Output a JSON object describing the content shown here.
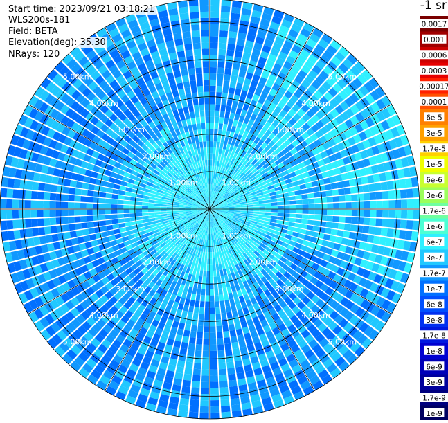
{
  "header": {
    "start_time": "Start time: 2023/09/21 03:18:21",
    "instrument": "WLS200s-181",
    "field": "Field: BETA",
    "elevation": "Elevation(deg): 35.30",
    "nrays": "NRays: 120"
  },
  "colorbar": {
    "units": "-1 sr",
    "labels": [
      "0.0017",
      "0.001",
      "0.0006",
      "0.0003",
      "0.00017",
      "0.0001",
      "6e-5",
      "3e-5",
      "1.7e-5",
      "1e-5",
      "6e-6",
      "3e-6",
      "1.7e-6",
      "1e-6",
      "6e-7",
      "3e-7",
      "1.7e-7",
      "1e-7",
      "6e-8",
      "3e-8",
      "1.7e-8",
      "1e-8",
      "6e-9",
      "3e-9",
      "1.7e-9",
      "1e-9"
    ],
    "colors": [
      "#7a0000",
      "#a00000",
      "#cc0000",
      "#e60000",
      "#ff2000",
      "#ff5000",
      "#ff8000",
      "#ffa000",
      "#ffd000",
      "#f0ff00",
      "#c8ff30",
      "#9cff5c",
      "#70ffa0",
      "#4cffd4",
      "#30f0ff",
      "#20c8ff",
      "#1098ff",
      "#0070ff",
      "#0050ff",
      "#0030f0",
      "#0018e0",
      "#0000d0",
      "#0000b8",
      "#00009c",
      "#00007e",
      "#000060"
    ]
  },
  "chart_data": {
    "type": "heatmap",
    "projection": "polar-ppi",
    "nrays": 120,
    "max_range_km": 5.6,
    "range_rings_km": [
      1.0,
      2.0,
      3.0,
      4.0,
      5.0
    ],
    "range_ring_labels": [
      "1.00km",
      "2.00km",
      "3.00km",
      "4.00km",
      "5.00km"
    ],
    "spokes_deg": [
      0,
      30,
      60,
      90,
      120,
      150
    ],
    "background_level": "1.7e-7",
    "inner_zone_level": "6e-7",
    "inner_zone_extent_km": 2.4,
    "enhanced_sector": {
      "azimuth_from_deg": 20,
      "azimuth_to_deg": 110,
      "range_km": [
        2.0,
        5.6
      ],
      "level": "3e-7"
    },
    "speckle_levels": [
      "6e-8",
      "1e-7",
      "1.7e-7",
      "3e-7",
      "6e-7"
    ]
  }
}
